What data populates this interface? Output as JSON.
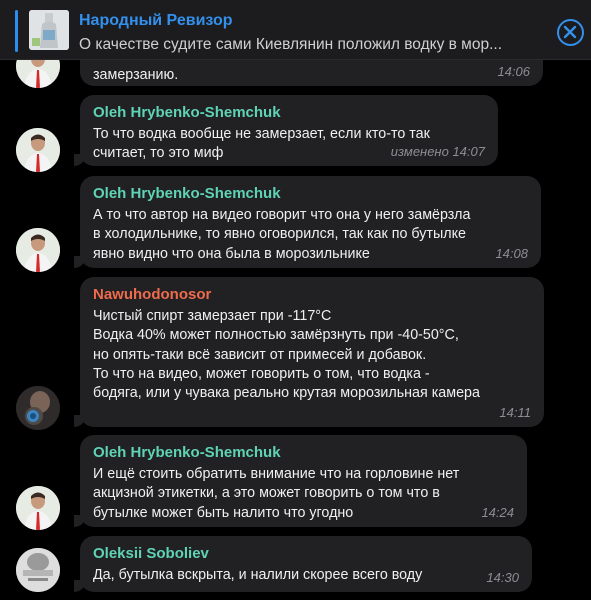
{
  "pinned": {
    "title": "Народный Ревизор",
    "text": "О качестве судите сами  Киевлянин положил водку в мор...",
    "thumb_icon": "bottle-photo-thumbnail",
    "close_icon": "close-icon",
    "accent": "#3390ec"
  },
  "messages": [
    {
      "text": "замерзанию.",
      "time": "14:06"
    },
    {
      "sender": "Oleh Hrybenko-Shemchuk",
      "text": "То что водка вообще не замерзает, если кто-то так\nсчитает, то это миф",
      "edited": "изменено",
      "time": "14:07"
    },
    {
      "sender": "Oleh Hrybenko-Shemchuk",
      "text": "А то что автор на видео говорит что она у него замёрзла\nв холодильнике, то явно оговорился, так как по бутылке\nявно видно что она была в морозильнике",
      "time": "14:08"
    },
    {
      "sender": "Nawuhodonosor",
      "text": "Чистый спирт замерзает при -117°C\nВодка 40% может полностью замёрзнуть при -40-50°C,\nно опять-таки всё зависит от примесей и добавок.\nТо что на видео, может говорить о том, что водка -\nбодяга, или у чувака реально крутая морозильная камера",
      "time": "14:11"
    },
    {
      "sender": "Oleh Hrybenko-Shemchuk",
      "text": "И ещё стоить обратить внимание что на горловине нет\nакцизной этикетки, а это может говорить о том что в\nбутылке может быть налито что угодно",
      "time": "14:24"
    },
    {
      "sender": "Oleksii Soboliev",
      "text": "Да, бутылка вскрыта, и налили скорее всего воду",
      "time": "14:30"
    }
  ],
  "colors": {
    "background": "#000000",
    "bubble": "#212123",
    "sender_green": "#5fd3b5",
    "sender_red": "#ee6b4d",
    "meta": "#8d8e93"
  }
}
